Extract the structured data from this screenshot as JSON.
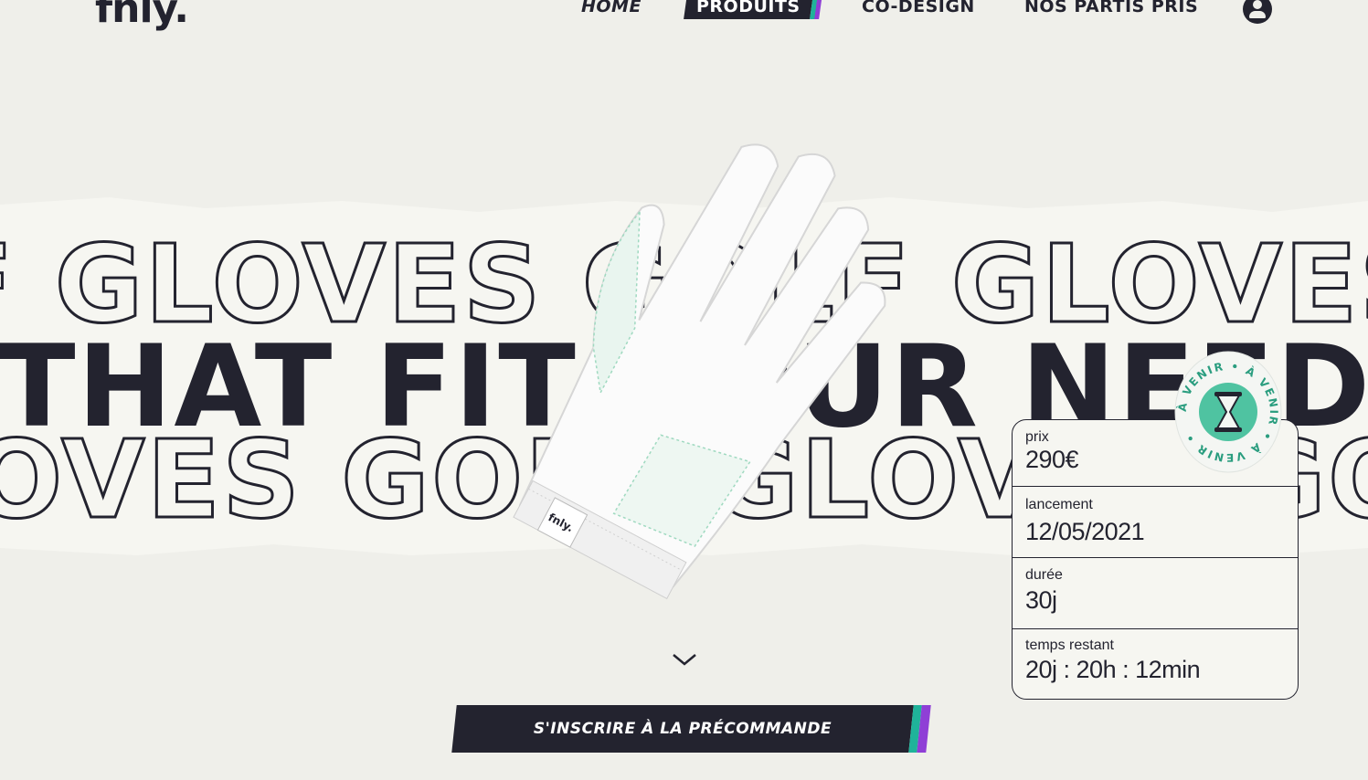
{
  "brand": {
    "logo": "fnly."
  },
  "nav": {
    "home": "HOME",
    "produits": "PRODUITS",
    "codesign": "CO-DESIGN",
    "partis": "NOS PARTIS PRIS"
  },
  "icons": {
    "account": "account-icon",
    "scroll": "chevron-down-icon",
    "badge": "hourglass-icon"
  },
  "hero": {
    "line1": "F GLOVES GOLF GLOVES GOLF G",
    "line2": "THAT FIT YOUR NEEDS THAT",
    "line3": "OVES GOLF GLOVES GOLF GLOVES",
    "glove_tag": "fnly."
  },
  "badge": {
    "text": "À VENIR • À VENIR • À VENIR • "
  },
  "info": {
    "prix_label": "prix",
    "prix_value": "290€",
    "lancement_label": "lancement",
    "lancement_value": "12/05/2021",
    "duree_label": "durée",
    "duree_value": "30j",
    "restant_label": "temps restant",
    "restant_value": "20j : 20h : 12min"
  },
  "cta": {
    "label": "S'INSCRIRE À LA PRÉCOMMANDE"
  },
  "colors": {
    "ink": "#23232f",
    "bg": "#efefea",
    "teal": "#1fb39a",
    "purple": "#8f3fd6",
    "mint": "#4fc3a1"
  }
}
